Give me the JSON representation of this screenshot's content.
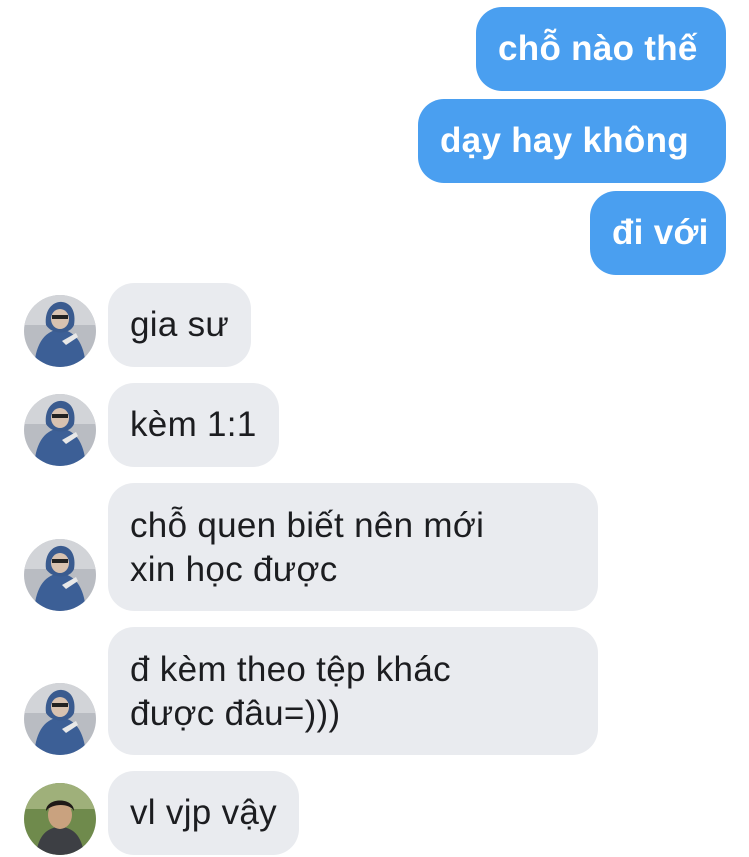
{
  "messages": [
    {
      "direction": "outgoing",
      "text": "chỗ nào thế"
    },
    {
      "direction": "outgoing",
      "text": "dạy hay không"
    },
    {
      "direction": "outgoing",
      "text": "đi với"
    },
    {
      "direction": "incoming",
      "avatar": "blue-hoodie-avatar",
      "text": "gia sư"
    },
    {
      "direction": "incoming",
      "avatar": "blue-hoodie-avatar",
      "text": "kèm 1:1"
    },
    {
      "direction": "incoming",
      "avatar": "blue-hoodie-avatar",
      "lines": [
        "chỗ quen biết nên mới",
        "xin học được"
      ]
    },
    {
      "direction": "incoming",
      "avatar": "blue-hoodie-avatar",
      "lines": [
        "đ kèm theo tệp khác",
        "được đâu=)))"
      ]
    },
    {
      "direction": "incoming",
      "avatar": "outdoor-person-avatar",
      "text": "vl vjp vậy"
    }
  ],
  "colors": {
    "outgoing_bubble": "#4a9ff0",
    "incoming_bubble": "#e9ebef",
    "outgoing_text": "#ffffff",
    "incoming_text": "#1c1d20"
  }
}
